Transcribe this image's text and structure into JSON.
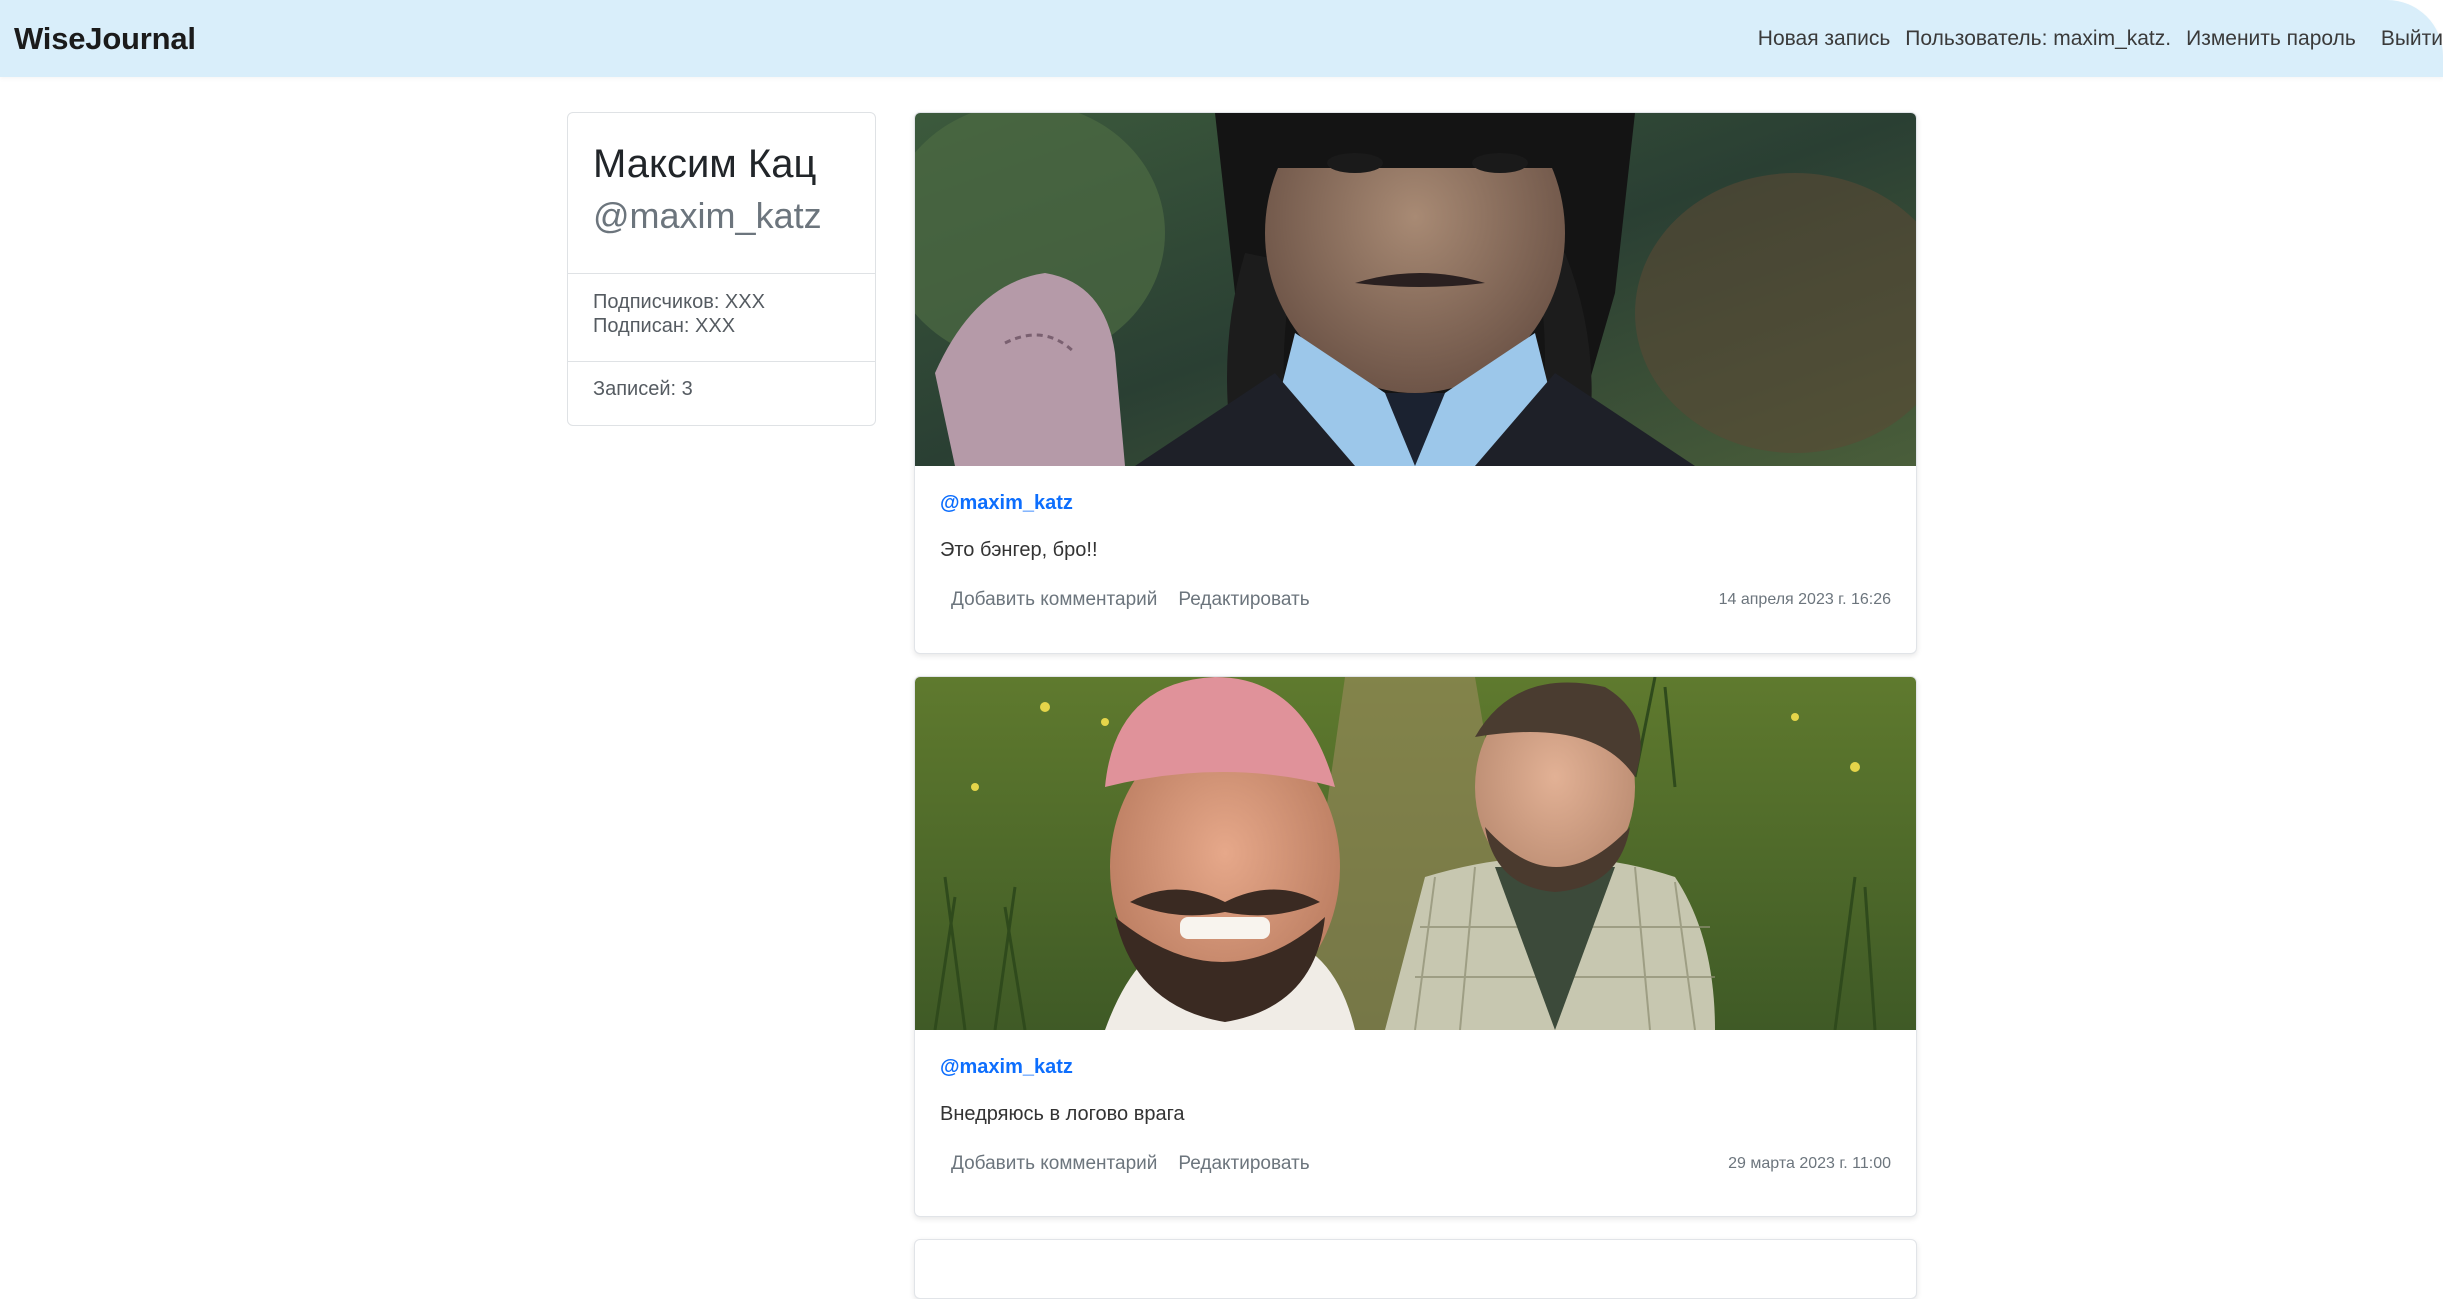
{
  "navbar": {
    "brand": "WiseJournal",
    "new_post": "Новая запись",
    "user": "Пользователь: maxim_katz.",
    "change_password": "Изменить пароль",
    "logout": "Выйти"
  },
  "profile": {
    "name": "Максим Кац",
    "handle": "@maxim_katz",
    "followers": "Подписчиков: XXX",
    "following": "Подписан: XXX",
    "posts_count": "Записей: 3"
  },
  "posts": [
    {
      "author": "@maxim_katz",
      "text": "Это бэнгер, бро!!",
      "add_comment": "Добавить комментарий",
      "edit": "Редактировать",
      "date": "14 апреля 2023 г. 16:26"
    },
    {
      "author": "@maxim_katz",
      "text": "Внедряюсь в логово врага",
      "add_comment": "Добавить комментарий",
      "edit": "Редактировать",
      "date": "29 марта 2023 г. 11:00"
    }
  ]
}
